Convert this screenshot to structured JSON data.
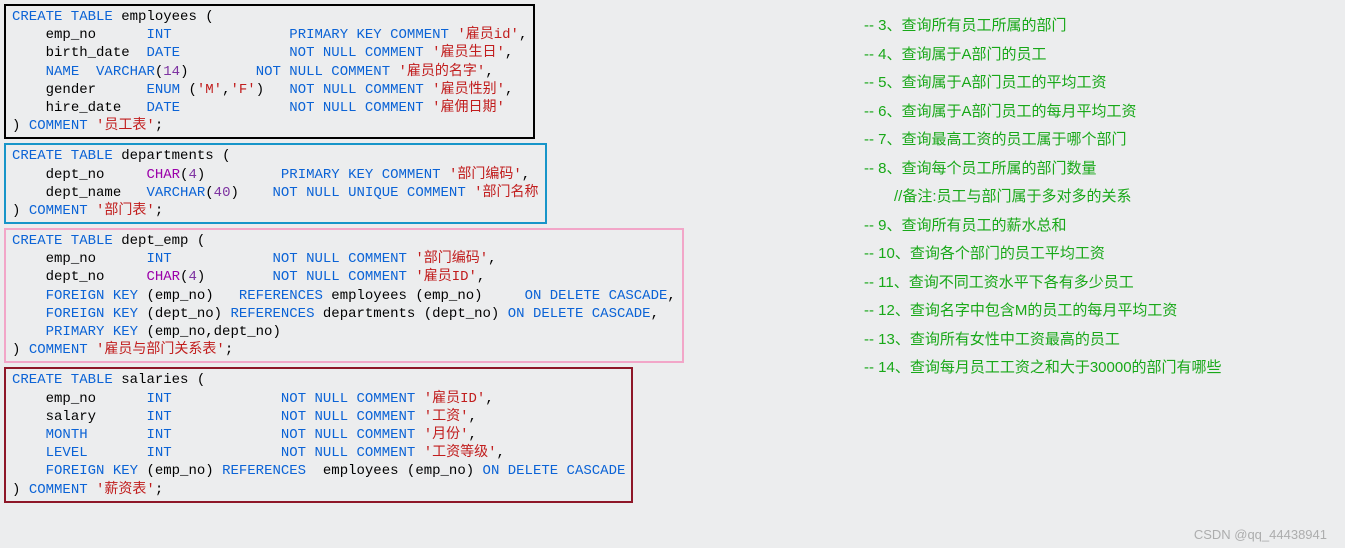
{
  "sql": {
    "t1": {
      "l1a": "CREATE TABLE",
      "l1b": "employees",
      "l1c": "(",
      "c1a": "emp_no",
      "c1b": "INT",
      "c1c": "PRIMARY KEY COMMENT",
      "c1d": "'雇员id'",
      "c1e": ",",
      "c2a": "birth_date",
      "c2b": "DATE",
      "c2c": "NOT NULL COMMENT",
      "c2d": "'雇员生日'",
      "c2e": ",",
      "c3a": "NAME",
      "c3b": "VARCHAR",
      "c3c": "(",
      "c3d": "14",
      "c3e": ")",
      "c3f": "NOT NULL COMMENT",
      "c3g": "'雇员的名字'",
      "c3h": ",",
      "c4a": "gender",
      "c4b": "ENUM",
      "c4c": "(",
      "c4d": "'M'",
      "c4e": ",",
      "c4f": "'F'",
      "c4g": ")",
      "c4h": "NOT NULL COMMENT",
      "c4i": "'雇员性别'",
      "c4j": ",",
      "c5a": "hire_date",
      "c5b": "DATE",
      "c5c": "NOT NULL COMMENT",
      "c5d": "'雇佣日期'",
      "end1": ")",
      "end2": "COMMENT",
      "end3": "'员工表'",
      "end4": ";"
    },
    "t2": {
      "l1a": "CREATE TABLE",
      "l1b": "departments",
      "l1c": "(",
      "c1a": "dept_no",
      "c1b": "CHAR",
      "c1c": "(",
      "c1d": "4",
      "c1e": ")",
      "c1f": "PRIMARY KEY COMMENT",
      "c1g": "'部门编码'",
      "c1h": ",",
      "c2a": "dept_name",
      "c2b": "VARCHAR",
      "c2c": "(",
      "c2d": "40",
      "c2e": ")",
      "c2f": "NOT NULL UNIQUE COMMENT",
      "c2g": "'部门名称",
      "end1": ")",
      "end2": "COMMENT",
      "end3": "'部门表'",
      "end4": ";"
    },
    "t3": {
      "l1a": "CREATE TABLE",
      "l1b": "dept_emp",
      "l1c": "(",
      "c1a": "emp_no",
      "c1b": "INT",
      "c1c": "NOT NULL COMMENT",
      "c1d": "'部门编码'",
      "c1e": ",",
      "c2a": "dept_no",
      "c2b": "CHAR",
      "c2c": "(",
      "c2d": "4",
      "c2e": ")",
      "c2f": "NOT NULL COMMENT",
      "c2g": "'雇员ID'",
      "c2h": ",",
      "f1a": "FOREIGN KEY",
      "f1b": "(emp_no)",
      "f1c": "REFERENCES",
      "f1d": "employees",
      "f1e": "(emp_no)",
      "f1f": "ON DELETE CASCADE",
      "f1g": ",",
      "f2a": "FOREIGN KEY",
      "f2b": "(dept_no)",
      "f2c": "REFERENCES",
      "f2d": "departments",
      "f2e": "(dept_no)",
      "f2f": "ON DELETE CASCADE",
      "f2g": ",",
      "p1a": "PRIMARY KEY",
      "p1b": "(emp_no,dept_no)",
      "end1": ")",
      "end2": "COMMENT",
      "end3": "'雇员与部门关系表'",
      "end4": ";"
    },
    "t4": {
      "l1a": "CREATE TABLE",
      "l1b": "salaries",
      "l1c": "(",
      "c1a": "emp_no",
      "c1b": "INT",
      "c1c": "NOT NULL COMMENT",
      "c1d": "'雇员ID'",
      "c1e": ",",
      "c2a": "salary",
      "c2b": "INT",
      "c2c": "NOT NULL COMMENT",
      "c2d": "'工资'",
      "c2e": ",",
      "c3a": "MONTH",
      "c3b": "INT",
      "c3c": "NOT NULL COMMENT",
      "c3d": "'月份'",
      "c3e": ",",
      "c4a": "LEVEL",
      "c4b": "INT",
      "c4c": "NOT NULL COMMENT",
      "c4d": "'工资等级'",
      "c4e": ",",
      "f1a": "FOREIGN KEY",
      "f1b": "(emp_no)",
      "f1c": "REFERENCES",
      "f1d": "employees",
      "f1e": "(emp_no)",
      "f1f": "ON DELETE CASCADE",
      "end1": ")",
      "end2": "COMMENT",
      "end3": "'薪资表'",
      "end4": ";"
    }
  },
  "tasks": {
    "t3": "-- 3、查询所有员工所属的部门",
    "t4": "-- 4、查询属于A部门的员工",
    "t5": "-- 5、查询属于A部门员工的平均工资",
    "t6": "-- 6、查询属于A部门员工的每月平均工资",
    "t7": "-- 7、查询最高工资的员工属于哪个部门",
    "t8": "-- 8、查询每个员工所属的部门数量",
    "note": "//备注:员工与部门属于多对多的关系",
    "t9": "-- 9、查询所有员工的薪水总和",
    "t10": "-- 10、查询各个部门的员工平均工资",
    "t11": "-- 11、查询不同工资水平下各有多少员工",
    "t12": "-- 12、查询名字中包含M的员工的每月平均工资",
    "t13": "-- 13、查询所有女性中工资最高的员工",
    "t14": "-- 14、查询每月员工工资之和大于30000的部门有哪些"
  },
  "watermark": "CSDN @qq_44438941"
}
